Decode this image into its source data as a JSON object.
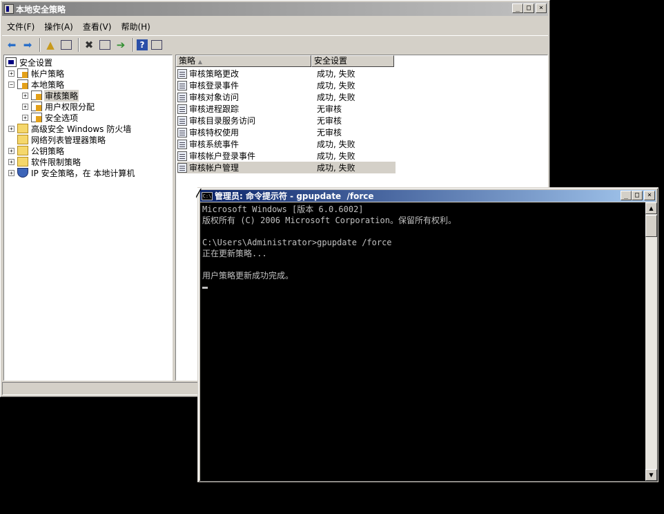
{
  "mmc": {
    "title": "本地安全策略",
    "menu": [
      "文件(F)",
      "操作(A)",
      "查看(V)",
      "帮助(H)"
    ],
    "tree": [
      {
        "label": "安全设置",
        "indent": 0,
        "expander": "",
        "icon": "security-settings-icon",
        "selected": false
      },
      {
        "label": "帐户策略",
        "indent": 1,
        "expander": "+",
        "icon": "folder-policy-icon",
        "selected": false
      },
      {
        "label": "本地策略",
        "indent": 1,
        "expander": "−",
        "icon": "folder-policy-icon",
        "selected": false
      },
      {
        "label": "审核策略",
        "indent": 2,
        "expander": "+",
        "icon": "folder-policy-icon",
        "selected": true
      },
      {
        "label": "用户权限分配",
        "indent": 2,
        "expander": "+",
        "icon": "folder-policy-icon",
        "selected": false
      },
      {
        "label": "安全选项",
        "indent": 2,
        "expander": "+",
        "icon": "folder-policy-icon",
        "selected": false
      },
      {
        "label": "高级安全 Windows 防火墙",
        "indent": 1,
        "expander": "+",
        "icon": "folder-icon",
        "selected": false
      },
      {
        "label": "网络列表管理器策略",
        "indent": 1,
        "expander": "",
        "icon": "folder-icon",
        "selected": false
      },
      {
        "label": "公钥策略",
        "indent": 1,
        "expander": "+",
        "icon": "folder-icon",
        "selected": false
      },
      {
        "label": "软件限制策略",
        "indent": 1,
        "expander": "+",
        "icon": "folder-icon",
        "selected": false
      },
      {
        "label": "IP 安全策略，在 本地计算机",
        "indent": 1,
        "expander": "+",
        "icon": "shield-icon",
        "selected": false
      }
    ],
    "list": {
      "columns": [
        "策略",
        "安全设置"
      ],
      "rows": [
        {
          "policy": "审核策略更改",
          "setting": "成功, 失败",
          "selected": false
        },
        {
          "policy": "审核登录事件",
          "setting": "成功, 失败",
          "selected": false
        },
        {
          "policy": "审核对象访问",
          "setting": "成功, 失败",
          "selected": false
        },
        {
          "policy": "审核进程跟踪",
          "setting": "无审核",
          "selected": false
        },
        {
          "policy": "审核目录服务访问",
          "setting": "无审核",
          "selected": false
        },
        {
          "policy": "审核特权使用",
          "setting": "无审核",
          "selected": false
        },
        {
          "policy": "审核系统事件",
          "setting": "成功, 失败",
          "selected": false
        },
        {
          "policy": "审核帐户登录事件",
          "setting": "成功, 失败",
          "selected": false
        },
        {
          "policy": "审核帐户管理",
          "setting": "成功, 失败",
          "selected": true
        }
      ]
    }
  },
  "cmd": {
    "title": "管理员: 命令提示符 - gpupdate  /force",
    "icon_text": "C:\\",
    "lines": [
      "Microsoft Windows [版本 6.0.6002]",
      "版权所有 (C) 2006 Microsoft Corporation。保留所有权利。",
      "",
      "C:\\Users\\Administrator>gpupdate /force",
      "正在更新策略...",
      "",
      "用户策略更新成功完成。"
    ]
  },
  "colors": {
    "desktop": "#000000",
    "cmd_title_active": "#0a246a",
    "mmc_title_inactive": "#808080",
    "console_text": "#c0c0c0"
  }
}
